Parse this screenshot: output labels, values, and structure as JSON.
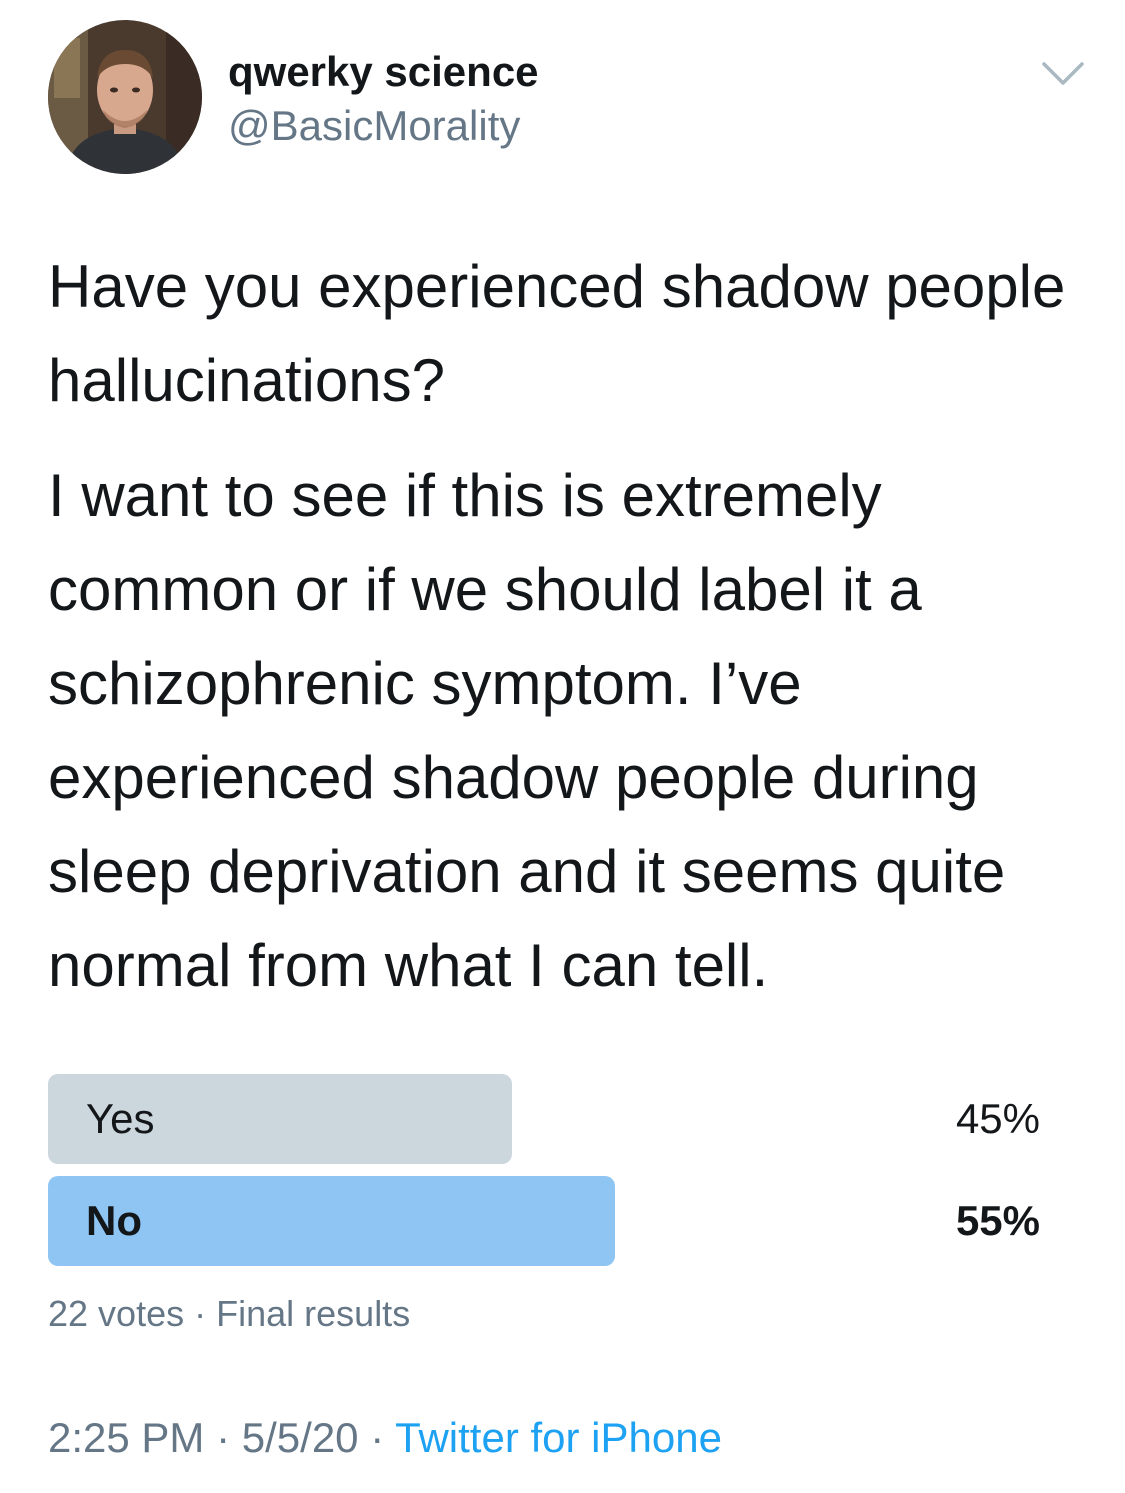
{
  "author": {
    "display_name": "qwerky science",
    "handle": "@BasicMorality"
  },
  "icons": {
    "avatar": "profile-photo",
    "more": "chevron-down-icon"
  },
  "tweet": {
    "paragraphs": [
      "Have you experienced shadow people hallucinations?",
      "I want to see if this is extremely common or if we should label it a schizophrenic symptom. I’ve experienced shadow people during sleep deprivation and it seems quite normal from what I can tell."
    ]
  },
  "poll": {
    "options": [
      {
        "label": "Yes",
        "percent_label": "45%",
        "share": 0.45,
        "color": "#ccd6dd",
        "winner": false
      },
      {
        "label": "No",
        "percent_label": "55%",
        "share": 0.55,
        "color": "#8ec5f3",
        "winner": true
      }
    ],
    "votes": "22 votes",
    "separator": "·",
    "status": "Final results"
  },
  "footer": {
    "time": "2:25 PM",
    "separator": "·",
    "date": "5/5/20",
    "source": "Twitter for iPhone"
  },
  "colors": {
    "text": "#14171a",
    "muted": "#657786",
    "link": "#1da1f2"
  }
}
